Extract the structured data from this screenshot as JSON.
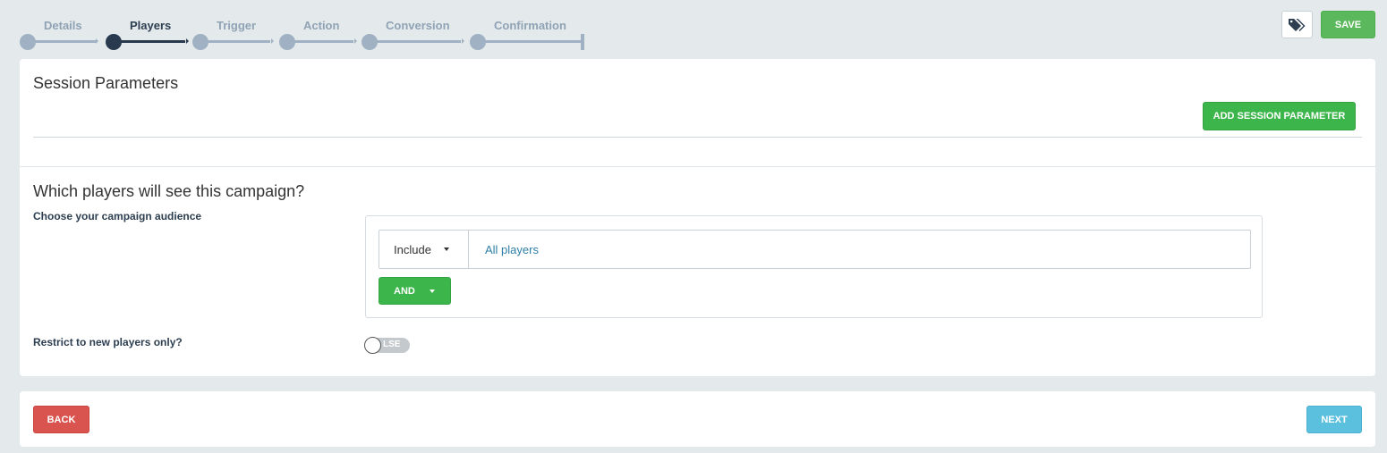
{
  "wizard": {
    "steps": [
      {
        "label": "Details",
        "state": "completed"
      },
      {
        "label": "Players",
        "state": "active"
      },
      {
        "label": "Trigger",
        "state": "pending"
      },
      {
        "label": "Action",
        "state": "pending"
      },
      {
        "label": "Conversion",
        "state": "pending"
      },
      {
        "label": "Confirmation",
        "state": "pending"
      }
    ]
  },
  "toolbar": {
    "tag_icon": "tags-icon",
    "save_label": "SAVE"
  },
  "session": {
    "title": "Session Parameters",
    "add_label": "ADD SESSION PARAMETER"
  },
  "audience": {
    "title": "Which players will see this campaign?",
    "label": "Choose your campaign audience",
    "rule": {
      "mode": "Include",
      "value": "All players"
    },
    "and_label": "AND"
  },
  "restrict": {
    "label": "Restrict to new players only?",
    "toggle_text": "LSE",
    "toggle_on": false
  },
  "footer": {
    "back_label": "BACK",
    "next_label": "NEXT"
  },
  "colors": {
    "background": "#e4e9ec",
    "green": "#3cb54a",
    "red": "#d9534f",
    "blue": "#5bc0de",
    "step_active": "#2a3a4e",
    "step_inactive": "#9fb1c3",
    "link": "#2f7fa6"
  }
}
